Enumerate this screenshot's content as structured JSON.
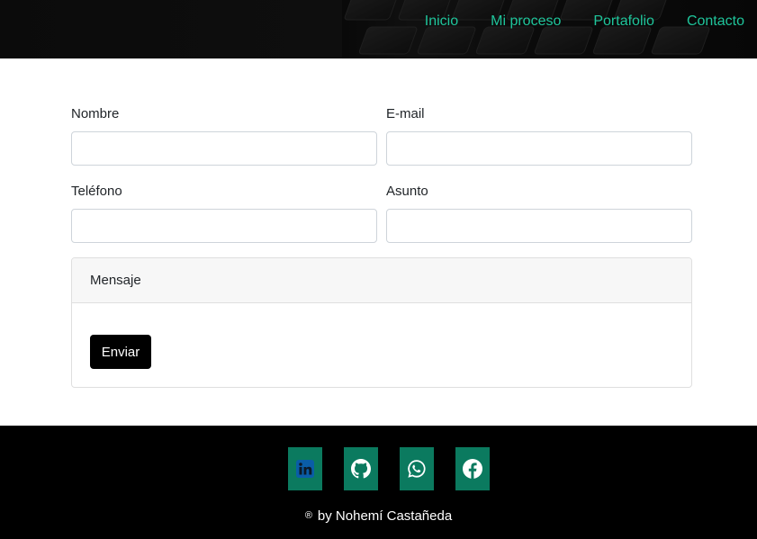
{
  "nav": {
    "items": [
      {
        "label": "Inicio"
      },
      {
        "label": "Mi proceso"
      },
      {
        "label": "Portafolio"
      },
      {
        "label": "Contacto"
      }
    ]
  },
  "form": {
    "nombre_label": "Nombre",
    "email_label": "E-mail",
    "telefono_label": "Teléfono",
    "asunto_label": "Asunto",
    "mensaje_label": "Mensaje",
    "submit_label": "Enviar"
  },
  "footer": {
    "social": [
      {
        "icon": "linkedin-icon"
      },
      {
        "icon": "github-icon"
      },
      {
        "icon": "whatsapp-icon"
      },
      {
        "icon": "facebook-icon"
      }
    ],
    "reg_symbol": "®",
    "credit": "by Nohemí Castañeda"
  },
  "colors": {
    "nav_link": "#1fc59b",
    "social_bg": "#0b7a5f",
    "button_bg": "#000000"
  }
}
